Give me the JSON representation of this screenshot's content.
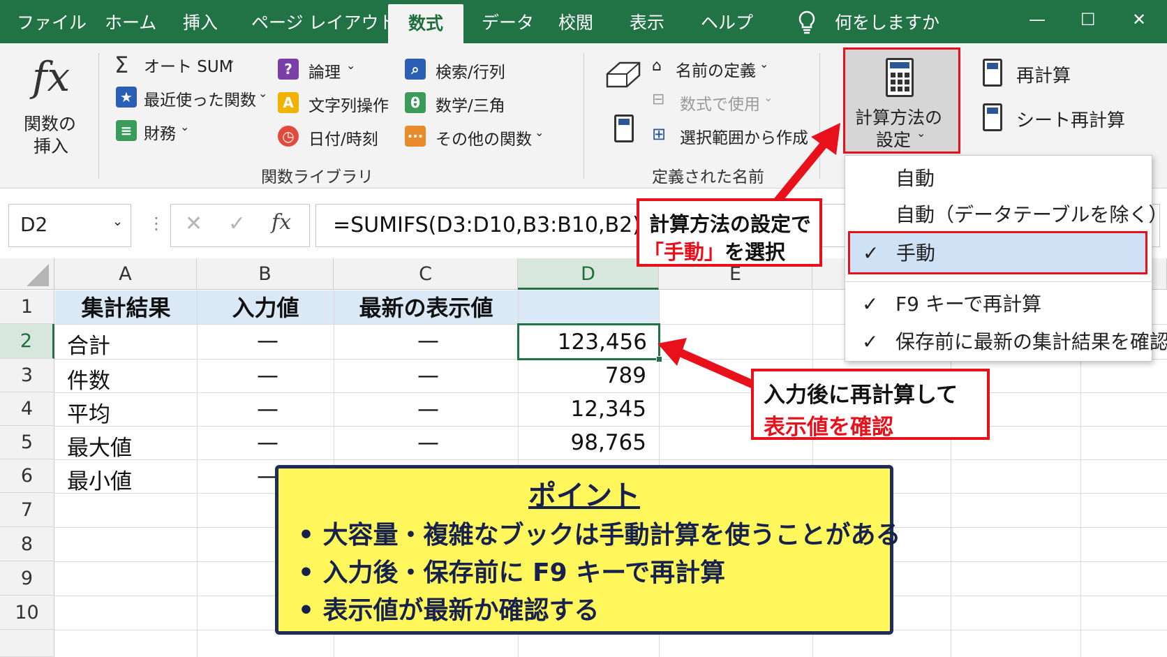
{
  "tabs": [
    "ファイル",
    "ホーム",
    "挿入",
    "ページ レイアウト",
    "数式",
    "データ",
    "校閲",
    "表示",
    "ヘルプ"
  ],
  "active_tab": "数式",
  "tellme": "何をしますか",
  "window_buttons": [
    "—",
    "☐",
    "✕"
  ],
  "ribbon": {
    "insert_function": {
      "symbol": "fx",
      "label_line1": "関数の",
      "label_line2": "挿入"
    },
    "library": {
      "autosum": "オート SUM",
      "recent": "最近使った関数",
      "financial": "財務",
      "logical": "論理",
      "text": "文字列操作",
      "datetime": "日付/時刻",
      "lookup": "検索/行列",
      "math": "数学/三角",
      "more": "その他の関数",
      "group_label": "関数ライブラリ"
    },
    "names": {
      "define": "名前の定義",
      "use_in_formula": "数式で使用",
      "create_from_selection": "選択範囲から作成",
      "group_label": "定義された名前"
    },
    "calc": {
      "options_line1": "計算方法の",
      "options_line2": "設定",
      "calc_now": "再計算",
      "calc_sheet": "シート再計算"
    }
  },
  "formula_bar": {
    "name_box": "D2",
    "formula": "=SUMIFS(D3:D10,B3:B10,B2)"
  },
  "columns": [
    "A",
    "B",
    "C",
    "D",
    "E"
  ],
  "rows": [
    "1",
    "2",
    "3",
    "4",
    "5",
    "6",
    "7",
    "8",
    "9",
    "10"
  ],
  "sheet": {
    "headers": [
      "集計結果",
      "入力値",
      "最新の表示値",
      ""
    ],
    "data": [
      {
        "a": "合計",
        "b": "—",
        "c": "—",
        "d": "123,456"
      },
      {
        "a": "件数",
        "b": "—",
        "c": "—",
        "d": "789"
      },
      {
        "a": "平均",
        "b": "—",
        "c": "—",
        "d": "12,345"
      },
      {
        "a": "最大値",
        "b": "—",
        "c": "—",
        "d": "98,765"
      },
      {
        "a": "最小値",
        "b": "—",
        "c": "",
        "d": ""
      }
    ]
  },
  "calc_menu": {
    "items": [
      "自動",
      "自動（データテーブルを除く）",
      "手動"
    ],
    "options": [
      "F9 キーで再計算",
      "保存前に最新の集計結果を確認"
    ],
    "check": "✓"
  },
  "callout_menu": {
    "line1": "計算方法の設定で",
    "line2_red": "「手動」",
    "line2_rest": "を選択"
  },
  "callout_cell": {
    "line1": "入力後に再計算して",
    "line2_red": "表示値を確認"
  },
  "point_box": {
    "title": "ポイント",
    "bullets": [
      "大容量・複雑なブックは手動計算を使うことがある",
      "入力後・保存前に F9 キーで再計算",
      "表示値が最新か確認する"
    ]
  },
  "colors": {
    "excel_green": "#217346",
    "highlight_red": "#e8111b",
    "point_yellow": "#fff75c",
    "header_blue": "#dbe9f6",
    "menu_selected": "#cfe1f5"
  }
}
